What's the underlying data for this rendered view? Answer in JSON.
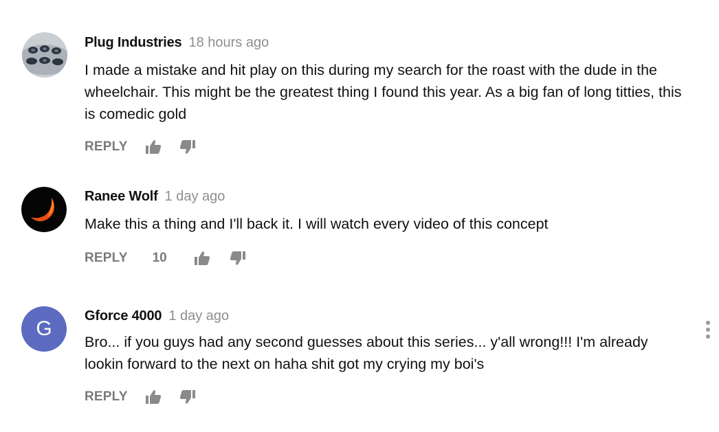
{
  "comments": [
    {
      "author": "Plug Industries",
      "time": "18 hours ago",
      "text": "I made a mistake and hit play on this during my search for the roast with the dude in the wheelchair. This might be the greatest thing I found this year. As a big fan of long titties, this is comedic gold",
      "reply_label": "REPLY",
      "likes": "",
      "avatar_type": "image"
    },
    {
      "author": "Ranee Wolf",
      "time": "1 day ago",
      "text": "Make this a thing and I'll back it. I will watch every video of this concept",
      "reply_label": "REPLY",
      "likes": "10",
      "avatar_type": "image"
    },
    {
      "author": "Gforce 4000",
      "time": "1 day ago",
      "text": "Bro... if you guys had any second guesses about this series... y'all wrong!!! I'm already lookin forward to the next on haha shit got my crying my boi's",
      "reply_label": "REPLY",
      "likes": "",
      "avatar_type": "letter",
      "avatar_letter": "G",
      "avatar_color": "#5c6bc0"
    }
  ],
  "icons": {
    "like": "thumb-up-icon",
    "dislike": "thumb-down-icon",
    "menu": "more-vert-icon"
  }
}
